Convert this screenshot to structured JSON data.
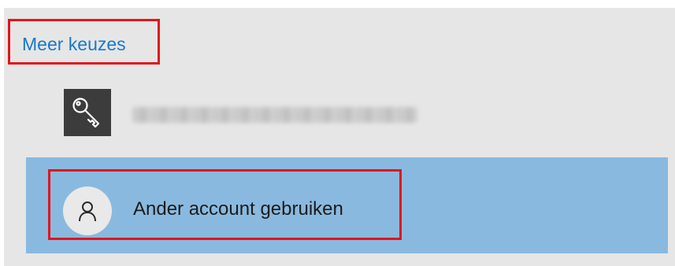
{
  "more_choices": {
    "label": "Meer keuzes"
  },
  "account_option": {
    "icon": "key-icon",
    "name": ""
  },
  "other_account": {
    "icon": "person-icon",
    "label": "Ander account gebruiken"
  },
  "colors": {
    "panel_bg": "#e6e6e6",
    "link": "#1a78c9",
    "selected_row": "#8ab9df",
    "highlight_border": "#e3141b",
    "key_tile": "#3c3c3c"
  }
}
